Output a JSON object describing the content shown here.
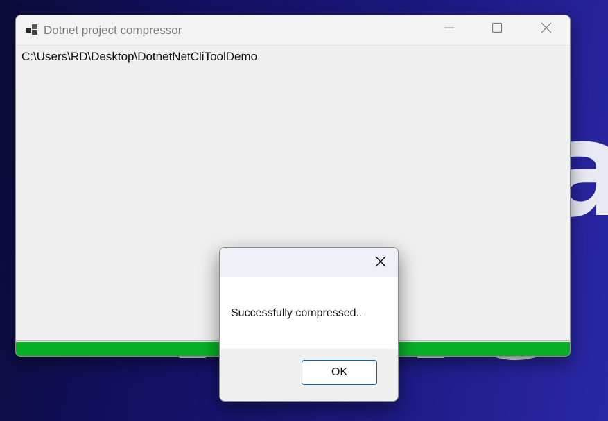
{
  "window": {
    "title": "Dotnet project compressor",
    "path_text": "C:\\Users\\RD\\Desktop\\DotnetNetCliToolDemo",
    "progress_fraction": 1.0,
    "progress_color": "#06b025"
  },
  "dialog": {
    "message": "Successfully compressed..",
    "ok_label": "OK",
    "accent_color": "#0067c0"
  },
  "wallpaper": {
    "text_line1": "a",
    "text_line2": "rrrlc"
  },
  "icons": {
    "app": "app-window-icon",
    "minimize": "minimize-icon",
    "maximize": "maximize-icon",
    "close": "close-icon"
  }
}
